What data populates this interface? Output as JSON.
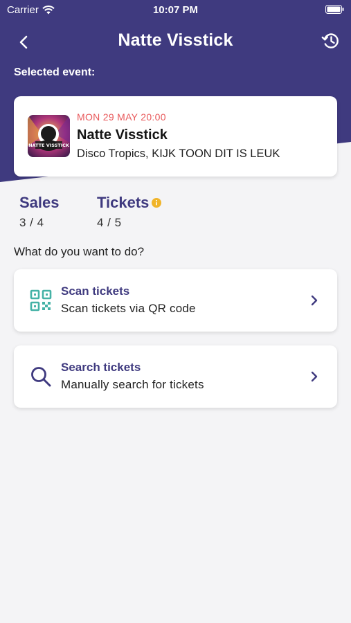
{
  "status_bar": {
    "carrier": "Carrier",
    "time": "10:07 PM"
  },
  "nav": {
    "title": "Natte Visstick",
    "back_icon": "chevron-left-icon",
    "history_icon": "history-icon"
  },
  "selected_label": "Selected event:",
  "event": {
    "date": "MON 29 MAY 20:00",
    "name": "Natte Visstick",
    "venue": "Disco Tropics, KIJK TOON DIT IS LEUK",
    "thumb_text": "NATTE VISSTICK"
  },
  "stats": {
    "sales": {
      "label": "Sales",
      "value": "3 / 4"
    },
    "tickets": {
      "label": "Tickets",
      "value": "4 / 5"
    }
  },
  "question": "What do you want to do?",
  "actions": [
    {
      "title": "Scan tickets",
      "subtitle": "Scan tickets via QR code",
      "icon": "qr-code-icon"
    },
    {
      "title": "Search tickets",
      "subtitle": "Manually search for tickets",
      "icon": "search-icon"
    }
  ],
  "colors": {
    "brand": "#3f3a7f",
    "date_accent": "#e8585a",
    "scan_icon": "#45b2a6",
    "info_badge": "#f0b429",
    "background": "#f4f4f6"
  }
}
